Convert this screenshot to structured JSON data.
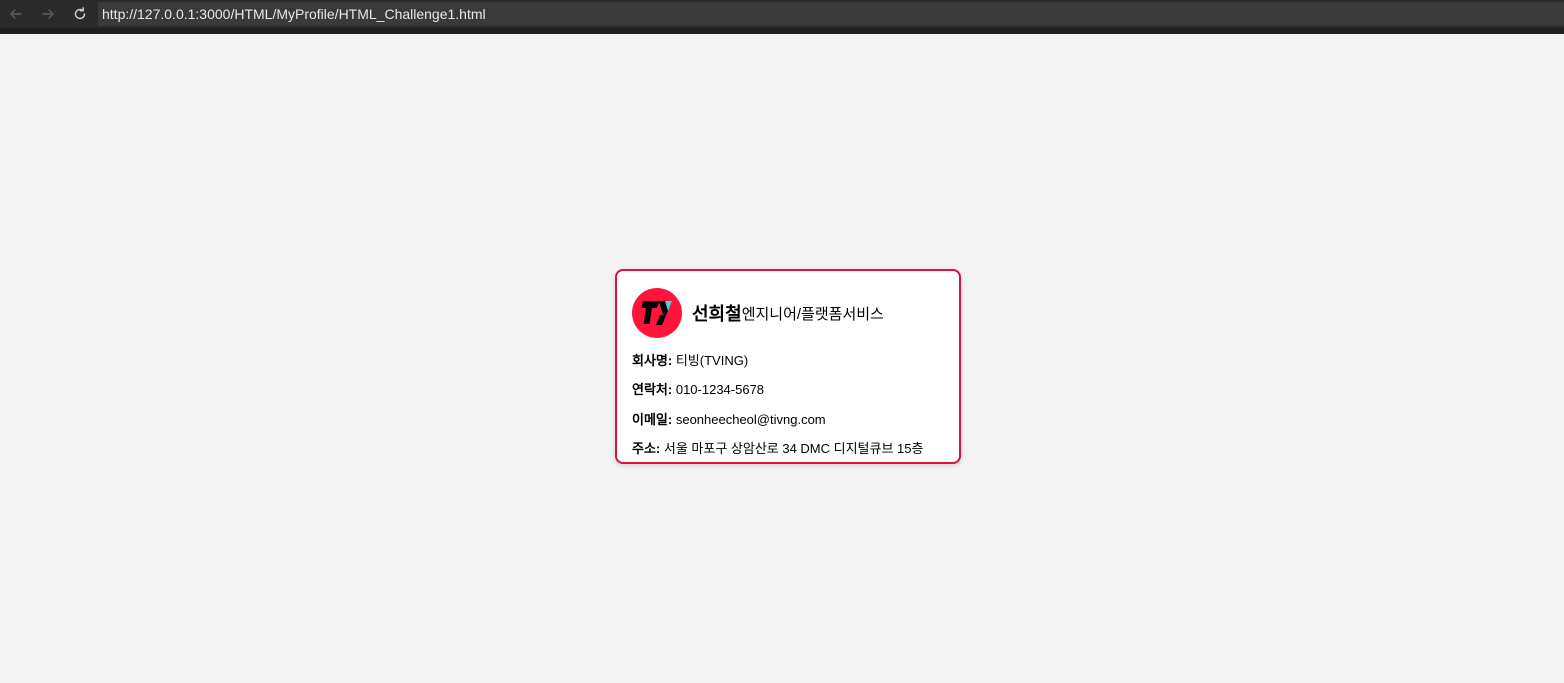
{
  "browser": {
    "url": "http://127.0.0.1:3000/HTML/MyProfile/HTML_Challenge1.html",
    "back_icon": "arrow-left-icon",
    "forward_icon": "arrow-right-icon",
    "reload_icon": "reload-icon"
  },
  "card": {
    "name": "선희철",
    "role": "엔지니어/플랫폼서비스",
    "logo_icon": "tving-logo",
    "border_color": "#e0103c",
    "rows": [
      {
        "label": "회사명:",
        "value": "티빙(TVING)"
      },
      {
        "label": "연락처:",
        "value": "010-1234-5678"
      },
      {
        "label": "이메일:",
        "value": "seonheecheol@tivng.com"
      },
      {
        "label": "주소:",
        "value": "서울 마포구 상암산로 34 DMC 디지털큐브 15층"
      }
    ]
  }
}
